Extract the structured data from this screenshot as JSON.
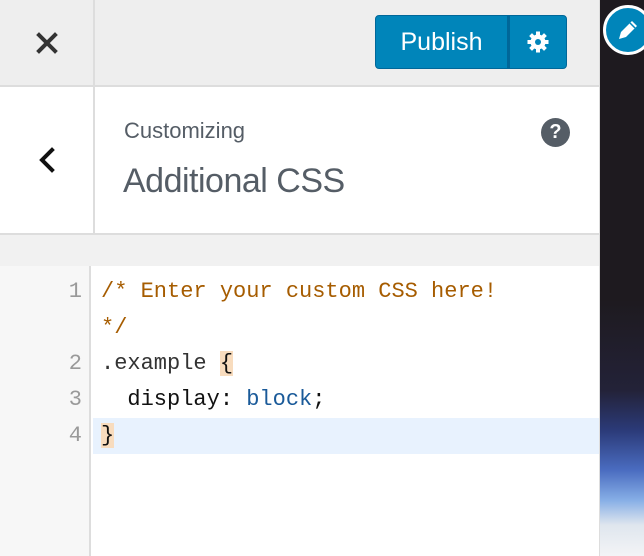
{
  "header": {
    "close_label": "Close",
    "publish_label": "Publish",
    "settings_label": "Publish settings"
  },
  "section": {
    "breadcrumb": "Customizing",
    "title": "Additional CSS",
    "help_label": "?"
  },
  "editor": {
    "lines": [
      {
        "number": "1",
        "text": "/* Enter your custom CSS here!"
      },
      {
        "number": "",
        "text": "*/"
      },
      {
        "number": "2",
        "selector": ".example ",
        "bracket": "{"
      },
      {
        "number": "3",
        "property": "  display: ",
        "value": "block",
        "end": ";"
      },
      {
        "number": "4",
        "bracket": "}"
      }
    ],
    "active_line": "4"
  },
  "colors": {
    "accent": "#0085ba",
    "comment": "#a65c00",
    "value": "#1a5a99",
    "bracket_match": "#f8dcbe",
    "active_line": "#e8f2fe"
  }
}
